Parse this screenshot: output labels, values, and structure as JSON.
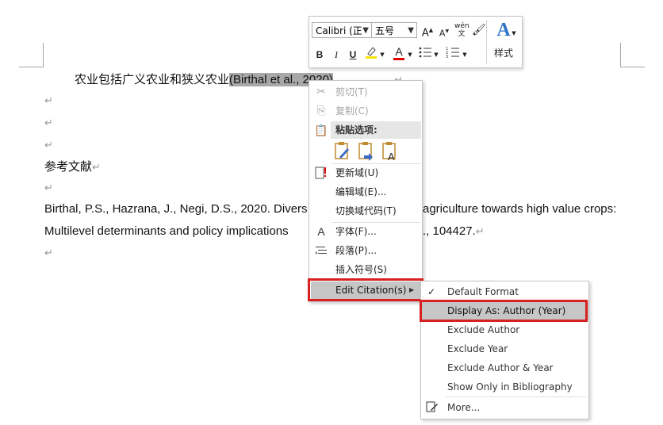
{
  "document": {
    "paragraph1_text": "农业包括广义农业和狭义农业",
    "paragraph1_citation": "(Birthal et al., 2020)",
    "heading": "参考文献",
    "ref_line1": "Birthal, P.S., Hazrana, J., Negi, D.S., 2020. Divers",
    "ref_line1_tail": "agriculture towards high value crops:",
    "ref_line2": "Multilevel determinants and policy implications",
    "ref_line2_tail": "., 104427.",
    "paragraph_mark": "↵"
  },
  "mini_toolbar": {
    "font_name": "Calibri (正",
    "font_size": "五号",
    "grow_font": "A",
    "shrink_font": "A",
    "phonetic": "wén",
    "bold": "B",
    "italic": "I",
    "underline": "U",
    "font_color": "A",
    "styles_label": "样式"
  },
  "context_menu": {
    "cut": "剪切(T)",
    "copy": "复制(C)",
    "paste_options": "粘贴选项:",
    "update_field": "更新域(U)",
    "edit_field": "编辑域(E)...",
    "toggle_field_codes": "切换域代码(T)",
    "font": "字体(F)...",
    "paragraph": "段落(P)...",
    "insert_symbol": "插入符号(S)",
    "edit_citation": "Edit Citation(s)"
  },
  "submenu": {
    "default_format": "Default Format",
    "display_as": "Display As: Author (Year)",
    "exclude_author": "Exclude Author",
    "exclude_year": "Exclude Year",
    "exclude_author_year": "Exclude Author & Year",
    "show_only_bibliography": "Show Only in Bibliography",
    "more": "More..."
  },
  "colors": {
    "highlight_red": "#d92020",
    "selection_gray": "#a8a8a8",
    "menu_hover": "#c6c6c6"
  }
}
